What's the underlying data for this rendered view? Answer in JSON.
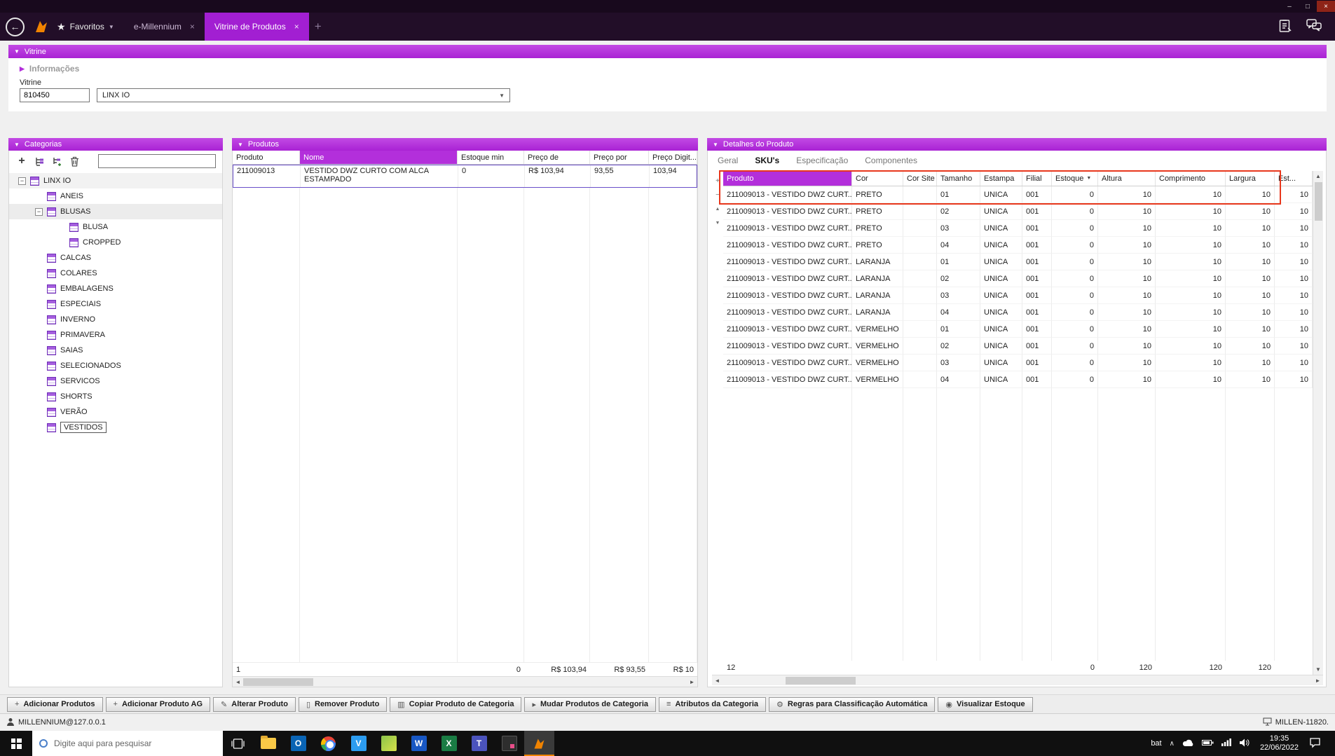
{
  "icons": {
    "minimize": "–",
    "maximize": "□",
    "close": "×",
    "back": "←",
    "star": "★",
    "collapse": "▼",
    "expand": "▶",
    "chevron": "▼",
    "plus": "+",
    "minus": "−",
    "up": "▲",
    "down": "▼",
    "left": "◄",
    "right": "►"
  },
  "nav": {
    "favorites_label": "Favoritos",
    "tabs": [
      {
        "label": "e-Millennium"
      },
      {
        "label": "Vitrine de Produtos"
      }
    ]
  },
  "vitrine": {
    "bar_title": "Vitrine",
    "info_title": "Informações",
    "field_label": "Vitrine",
    "code_value": "810450",
    "select_value": "LINX IO"
  },
  "categorias": {
    "title": "Categorias",
    "search_value": "",
    "tree": [
      {
        "label": "LINX IO"
      },
      {
        "label": "ANEIS"
      },
      {
        "label": "BLUSAS"
      },
      {
        "label": "BLUSA"
      },
      {
        "label": "CROPPED"
      },
      {
        "label": "CALCAS"
      },
      {
        "label": "COLARES"
      },
      {
        "label": "EMBALAGENS"
      },
      {
        "label": "ESPECIAIS"
      },
      {
        "label": "INVERNO"
      },
      {
        "label": "PRIMAVERA"
      },
      {
        "label": "SAIAS"
      },
      {
        "label": "SELECIONADOS"
      },
      {
        "label": "SERVICOS"
      },
      {
        "label": "SHORTS"
      },
      {
        "label": "VERÃO"
      },
      {
        "label": "VESTIDOS"
      }
    ]
  },
  "produtos": {
    "title": "Produtos",
    "columns": [
      "Produto",
      "Nome",
      "Estoque min",
      "Preço de",
      "Preço por",
      "Preço Digit..."
    ],
    "row": {
      "produto": "211009013",
      "nome": "VESTIDO DWZ CURTO COM ALCA ESTAMPADO",
      "estoque_min": "0",
      "preco_de": "R$ 103,94",
      "preco_por": "93,55",
      "preco_digit": "103,94"
    },
    "footer": {
      "count": "1",
      "estoque_min": "0",
      "preco_de": "R$ 103,94",
      "preco_por": "R$ 93,55",
      "preco_digit": "R$ 10"
    }
  },
  "detalhes": {
    "title": "Detalhes do Produto",
    "tabs": [
      "Geral",
      "SKU's",
      "Especificação",
      "Componentes"
    ],
    "columns": [
      "Produto",
      "Cor",
      "Cor Site",
      "Tamanho",
      "Estampa",
      "Filial",
      "Estoque",
      "Altura",
      "Comprimento",
      "Largura",
      "Est..."
    ],
    "rows": [
      {
        "produto": "211009013 - VESTIDO DWZ CURT...",
        "cor": "PRETO",
        "cor_site": "",
        "tamanho": "01",
        "estampa": "UNICA",
        "filial": "001",
        "estoque": "0",
        "altura": "10",
        "comprimento": "10",
        "largura": "10",
        "est": "10"
      },
      {
        "produto": "211009013 - VESTIDO DWZ CURT...",
        "cor": "PRETO",
        "cor_site": "",
        "tamanho": "02",
        "estampa": "UNICA",
        "filial": "001",
        "estoque": "0",
        "altura": "10",
        "comprimento": "10",
        "largura": "10",
        "est": "10"
      },
      {
        "produto": "211009013 - VESTIDO DWZ CURT...",
        "cor": "PRETO",
        "cor_site": "",
        "tamanho": "03",
        "estampa": "UNICA",
        "filial": "001",
        "estoque": "0",
        "altura": "10",
        "comprimento": "10",
        "largura": "10",
        "est": "10"
      },
      {
        "produto": "211009013 - VESTIDO DWZ CURT...",
        "cor": "PRETO",
        "cor_site": "",
        "tamanho": "04",
        "estampa": "UNICA",
        "filial": "001",
        "estoque": "0",
        "altura": "10",
        "comprimento": "10",
        "largura": "10",
        "est": "10"
      },
      {
        "produto": "211009013 - VESTIDO DWZ CURT...",
        "cor": "LARANJA",
        "cor_site": "",
        "tamanho": "01",
        "estampa": "UNICA",
        "filial": "001",
        "estoque": "0",
        "altura": "10",
        "comprimento": "10",
        "largura": "10",
        "est": "10"
      },
      {
        "produto": "211009013 - VESTIDO DWZ CURT...",
        "cor": "LARANJA",
        "cor_site": "",
        "tamanho": "02",
        "estampa": "UNICA",
        "filial": "001",
        "estoque": "0",
        "altura": "10",
        "comprimento": "10",
        "largura": "10",
        "est": "10"
      },
      {
        "produto": "211009013 - VESTIDO DWZ CURT...",
        "cor": "LARANJA",
        "cor_site": "",
        "tamanho": "03",
        "estampa": "UNICA",
        "filial": "001",
        "estoque": "0",
        "altura": "10",
        "comprimento": "10",
        "largura": "10",
        "est": "10"
      },
      {
        "produto": "211009013 - VESTIDO DWZ CURT...",
        "cor": "LARANJA",
        "cor_site": "",
        "tamanho": "04",
        "estampa": "UNICA",
        "filial": "001",
        "estoque": "0",
        "altura": "10",
        "comprimento": "10",
        "largura": "10",
        "est": "10"
      },
      {
        "produto": "211009013 - VESTIDO DWZ CURT...",
        "cor": "VERMELHO",
        "cor_site": "",
        "tamanho": "01",
        "estampa": "UNICA",
        "filial": "001",
        "estoque": "0",
        "altura": "10",
        "comprimento": "10",
        "largura": "10",
        "est": "10"
      },
      {
        "produto": "211009013 - VESTIDO DWZ CURT...",
        "cor": "VERMELHO",
        "cor_site": "",
        "tamanho": "02",
        "estampa": "UNICA",
        "filial": "001",
        "estoque": "0",
        "altura": "10",
        "comprimento": "10",
        "largura": "10",
        "est": "10"
      },
      {
        "produto": "211009013 - VESTIDO DWZ CURT...",
        "cor": "VERMELHO",
        "cor_site": "",
        "tamanho": "03",
        "estampa": "UNICA",
        "filial": "001",
        "estoque": "0",
        "altura": "10",
        "comprimento": "10",
        "largura": "10",
        "est": "10"
      },
      {
        "produto": "211009013 - VESTIDO DWZ CURT...",
        "cor": "VERMELHO",
        "cor_site": "",
        "tamanho": "04",
        "estampa": "UNICA",
        "filial": "001",
        "estoque": "0",
        "altura": "10",
        "comprimento": "10",
        "largura": "10",
        "est": "10"
      }
    ],
    "footer": {
      "count": "12",
      "estoque": "0",
      "altura": "120",
      "comprimento": "120",
      "largura": "120"
    }
  },
  "actions": [
    {
      "label": "Adicionar Produtos",
      "icon": "+"
    },
    {
      "label": "Adicionar Produto AG",
      "icon": "+"
    },
    {
      "label": "Alterar Produto",
      "icon": "✎"
    },
    {
      "label": "Remover Produto",
      "icon": "▯"
    },
    {
      "label": "Copiar Produto de Categoria",
      "icon": "▥"
    },
    {
      "label": "Mudar Produtos de Categoria",
      "icon": "▸"
    },
    {
      "label": "Atributos da Categoria",
      "icon": "≡"
    },
    {
      "label": "Regras para Classificação Automática",
      "icon": "⚙"
    },
    {
      "label": "Visualizar Estoque",
      "icon": "◉"
    }
  ],
  "statusbar": {
    "connection": "MILLENNIUM@127.0.0.1",
    "machine": "MILLEN-11820."
  },
  "taskbar": {
    "search_placeholder": "Digite aqui para pesquisar",
    "battery_label": "bat",
    "time": "19:35",
    "date": "22/06/2022"
  }
}
